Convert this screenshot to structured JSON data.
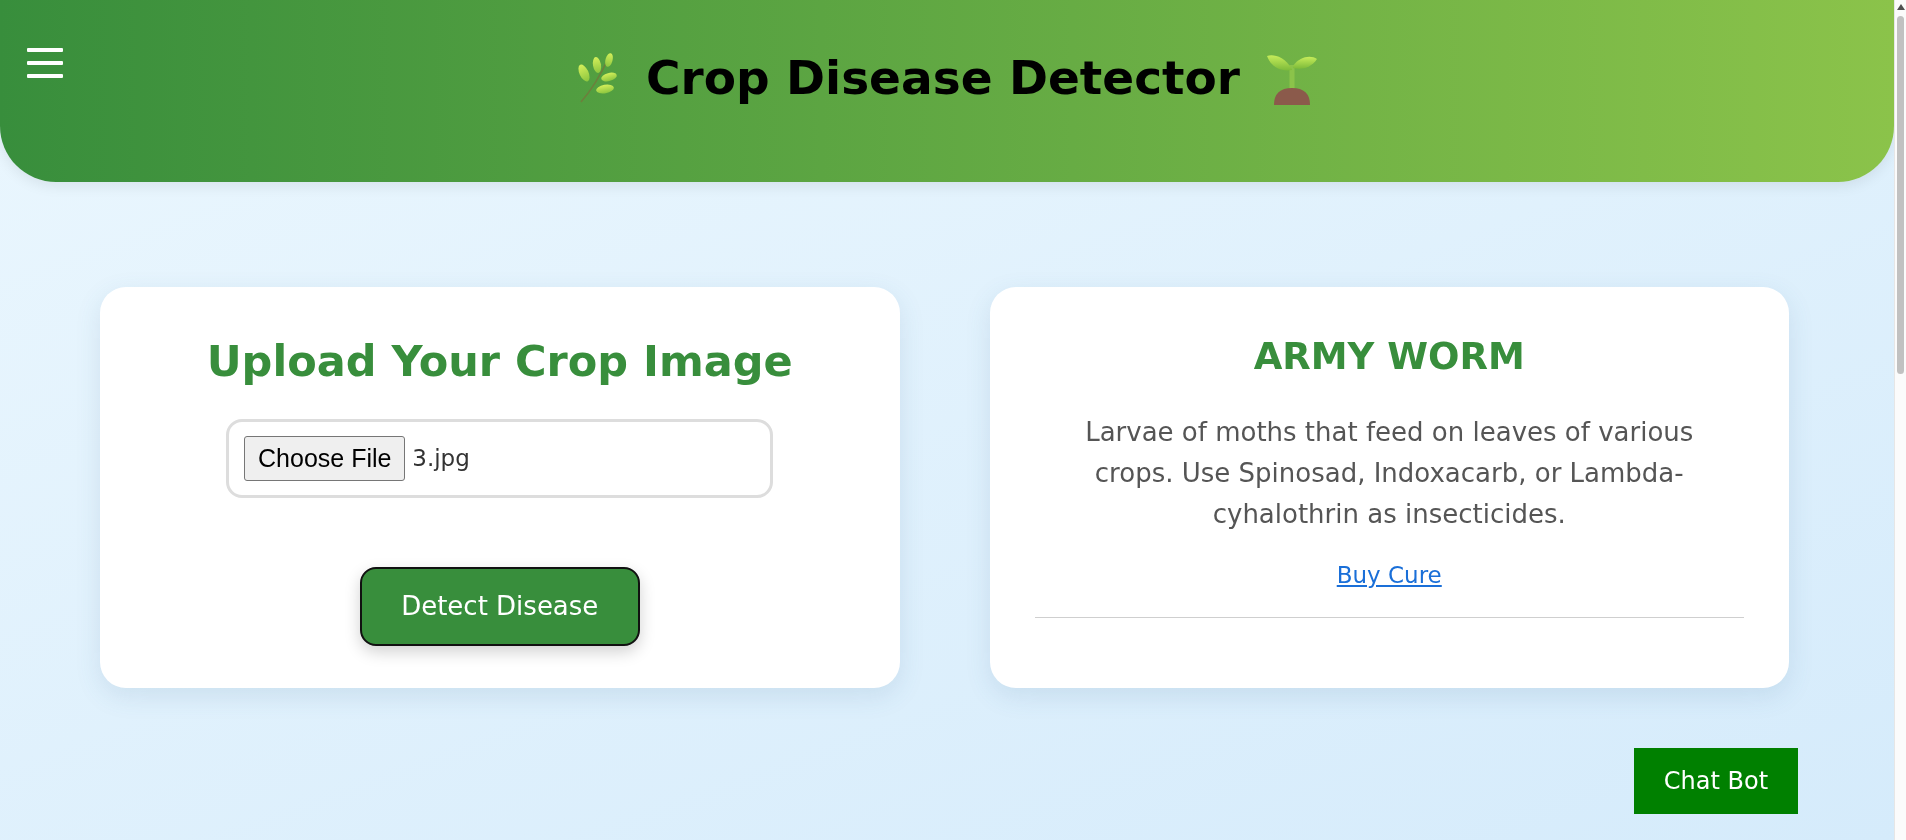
{
  "header": {
    "title": "Crop Disease Detector"
  },
  "upload_card": {
    "heading": "Upload Your Crop Image",
    "file_input": {
      "button": "Choose File",
      "file_name": "3.jpg"
    },
    "submit_button": "Detect Disease"
  },
  "result_card": {
    "heading": "ARMY WORM",
    "description": "Larvae of moths that feed on leaves of various crops. Use Spinosad, Indoxacarb, or Lambda-cyhalothrin as insecticides.",
    "link": "Buy Cure"
  },
  "chat_button": {
    "label": "Chat Bot"
  }
}
